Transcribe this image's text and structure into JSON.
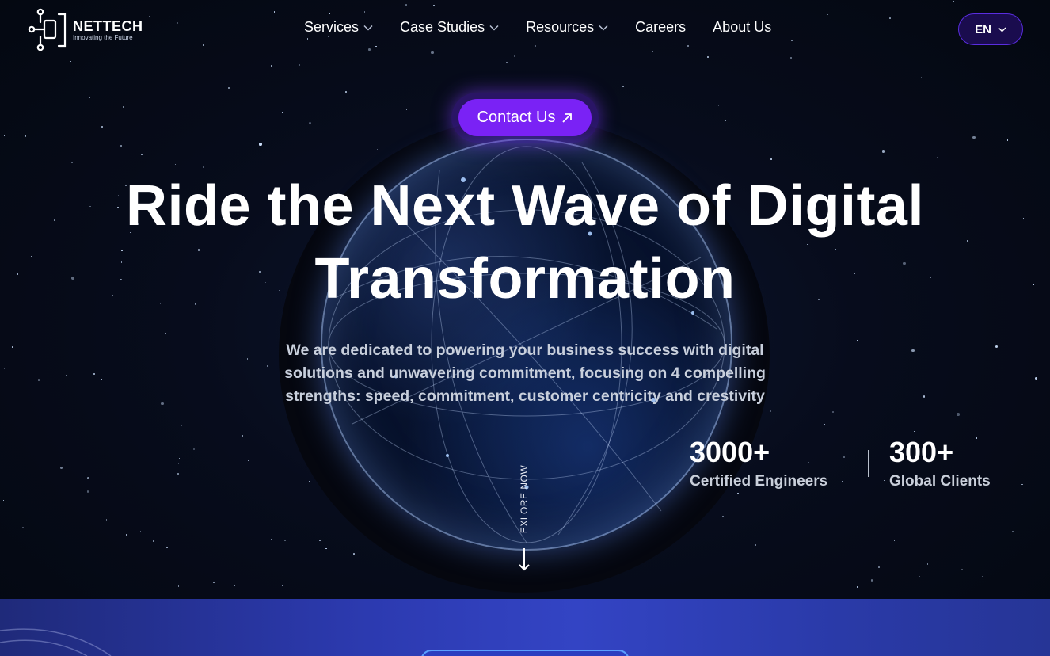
{
  "brand": {
    "name": "NETTECH",
    "tagline": "Innovating the Future"
  },
  "nav": {
    "items": [
      {
        "label": "Services",
        "has_dropdown": true
      },
      {
        "label": "Case Studies",
        "has_dropdown": true
      },
      {
        "label": "Resources",
        "has_dropdown": true
      },
      {
        "label": "Careers",
        "has_dropdown": false
      },
      {
        "label": "About Us",
        "has_dropdown": false
      }
    ]
  },
  "language": {
    "selected": "EN"
  },
  "hero": {
    "contact_label": "Contact Us",
    "headline_line1": "Ride the Next Wave of Digital",
    "headline_line2": "Transformation",
    "subtext_line1": "We are dedicated to powering your business success with digital",
    "subtext_line2": "solutions and unwavering commitment, focusing on 4 compelling",
    "subtext_line3": "strengths: speed, commitment, customer centricity and crestivity",
    "explore_label": "EXLORE NOW"
  },
  "stats": [
    {
      "value": "3000+",
      "label": "Certified Engineers"
    },
    {
      "value": "300+",
      "label": "Global Clients"
    }
  ],
  "colors": {
    "background": "#050a16",
    "accent_purple": "#7a22f5",
    "lang_bg": "#1a0c4e",
    "band_blue": "#2c3ab0"
  }
}
